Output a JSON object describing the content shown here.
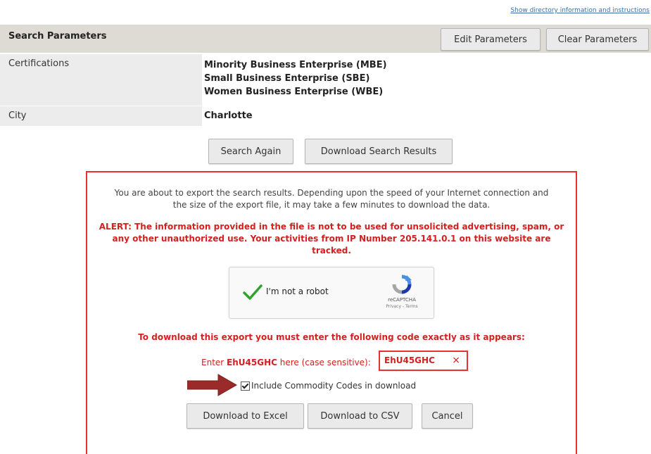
{
  "top_link": "Show directory information and instructions",
  "params": {
    "title": "Search Parameters",
    "edit_button": "Edit Parameters",
    "clear_button": "Clear Parameters",
    "rows": [
      {
        "label": "Certifications",
        "values": [
          "Minority Business Enterprise (MBE)",
          "Small Business Enterprise (SBE)",
          "Women Business Enterprise (WBE)"
        ]
      },
      {
        "label": "City",
        "values": [
          "Charlotte"
        ]
      }
    ]
  },
  "actions": {
    "search_again": "Search Again",
    "download_results": "Download Search Results"
  },
  "dialog": {
    "message_line1": "You are about to export the search results. Depending upon the speed of your Internet connection and",
    "message_line2": "the size of the export file, it may take a few minutes to download the data.",
    "alert_line1": "ALERT: The information provided in the file is not to be used for unsolicited advertising, spam, or",
    "alert_line2": "any other unauthorized use. Your activities from IP Number 205.141.0.1 on this website are",
    "alert_line3": "tracked.",
    "captcha": {
      "label": "I'm not a robot",
      "brand": "reCAPTCHA",
      "terms": "Privacy - Terms",
      "checked": true
    },
    "instruction": "To download this export you must enter the following code exactly as it appears:",
    "enter_prefix": "Enter",
    "code": "EhU45GHC",
    "enter_suffix": "here (case sensitive):",
    "code_input_value": "EhU45GHC",
    "clear_symbol": "×",
    "include_label": "Include Commodity Codes in download",
    "include_checked": true,
    "download_excel": "Download to Excel",
    "download_csv": "Download to CSV",
    "cancel": "Cancel"
  },
  "colors": {
    "alert_red": "#d42020",
    "header_bg": "#dedbd5",
    "label_bg": "#ececec",
    "arrow": "#9b2b2b"
  }
}
